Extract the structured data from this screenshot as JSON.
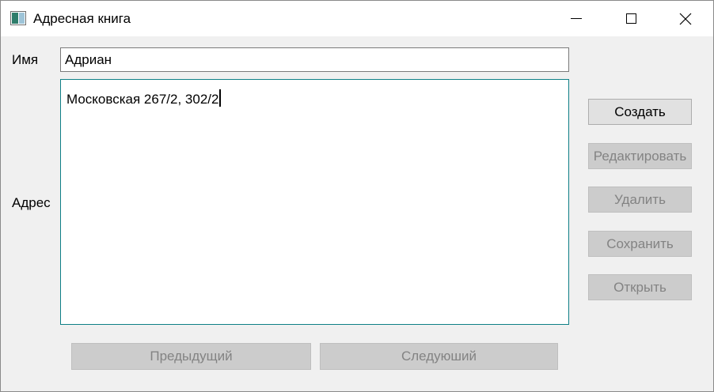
{
  "window": {
    "title": "Адресная книга",
    "icon": "app-window-icon"
  },
  "form": {
    "name_label": "Имя",
    "name_value": "Адриан",
    "address_label": "Адрес",
    "address_value": "Московская 267/2, 302/2"
  },
  "actions": {
    "create": "Создать",
    "edit": "Редактировать",
    "delete": "Удалить",
    "save": "Сохранить",
    "open": "Открыть"
  },
  "navigation": {
    "previous": "Предыдущий",
    "next": "Следуюший"
  },
  "colors": {
    "address_focus_border": "#0e7f86",
    "disabled_button": "#cccccc",
    "disabled_text": "#838383"
  }
}
